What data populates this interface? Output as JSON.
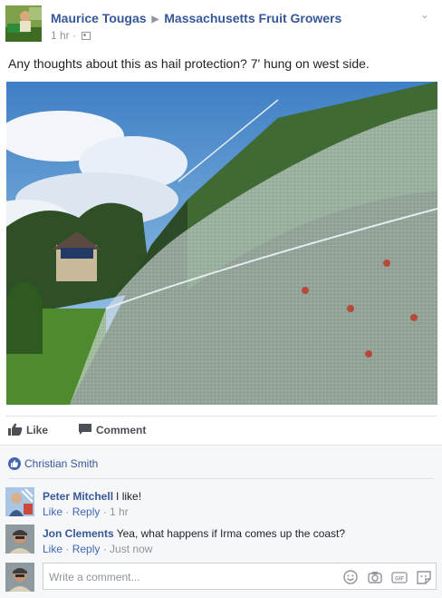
{
  "header": {
    "author": "Maurice Tougas",
    "group": "Massachusetts Fruit Growers",
    "time": "1 hr",
    "separator": "·"
  },
  "post": {
    "text": "Any thoughts about this as hail protection? 7' hung on west side."
  },
  "actions": {
    "like_label": "Like",
    "comment_label": "Comment"
  },
  "likes": {
    "names": "Christian Smith"
  },
  "comments": [
    {
      "author": "Peter Mitchell",
      "text": "I like!",
      "like_label": "Like",
      "reply_label": "Reply",
      "time": "1 hr"
    },
    {
      "author": "Jon Clements",
      "text": "Yea, what happens if Irma comes up the coast?",
      "like_label": "Like",
      "reply_label": "Reply",
      "time": "Just now"
    }
  ],
  "composer": {
    "placeholder": "Write a comment...",
    "icons": [
      "emoji-icon",
      "camera-icon",
      "gif-icon",
      "sticker-icon"
    ]
  },
  "colors": {
    "link": "#365899",
    "meta": "#90949c",
    "like_blue": "#4267b2",
    "footer_bg": "#f6f7f9"
  }
}
